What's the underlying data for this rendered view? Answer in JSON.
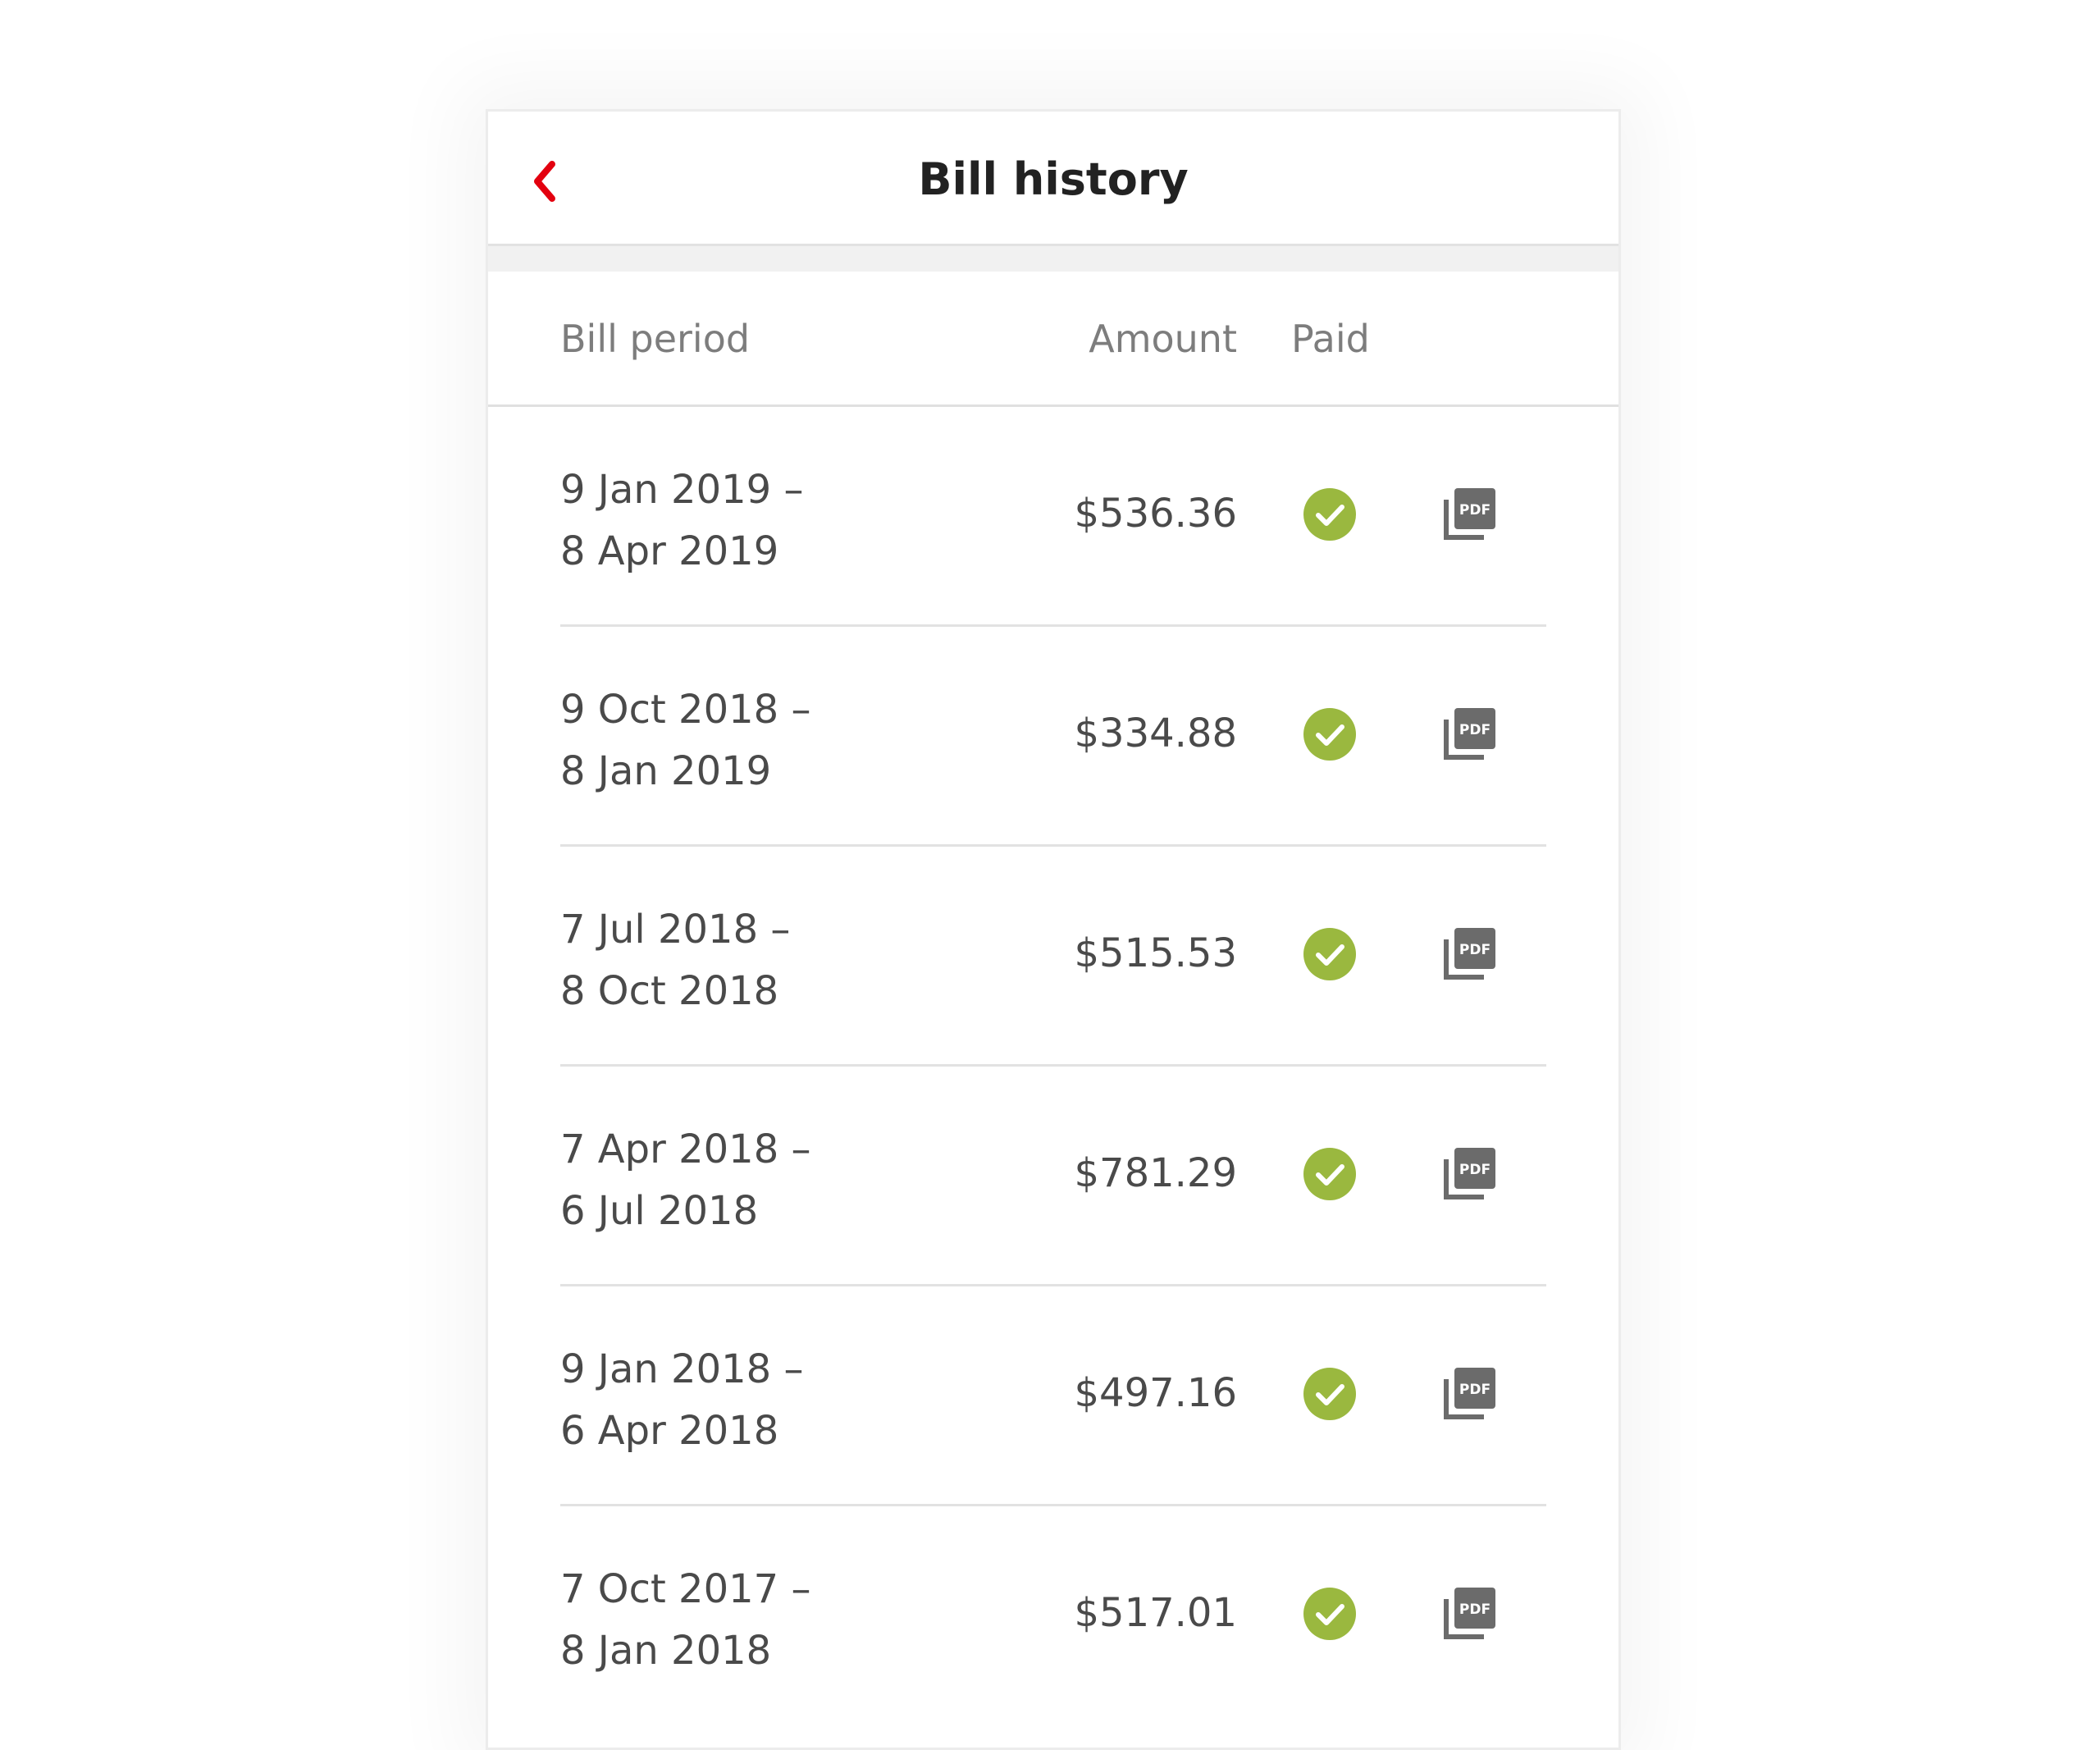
{
  "header": {
    "title": "Bill history",
    "back_icon": "chevron-left-icon",
    "accent_color": "#e3000f"
  },
  "columns": {
    "period": "Bill period",
    "amount": "Amount",
    "paid": "Paid"
  },
  "status_color": "#9ab83f",
  "bills": [
    {
      "start": "9 Jan 2019 –",
      "end": "8 Apr 2019",
      "amount": "$536.36",
      "paid": true,
      "pdf_label": "PDF"
    },
    {
      "start": "9 Oct 2018 –",
      "end": "8 Jan 2019",
      "amount": "$334.88",
      "paid": true,
      "pdf_label": "PDF"
    },
    {
      "start": "7 Jul 2018 –",
      "end": "8 Oct 2018",
      "amount": "$515.53",
      "paid": true,
      "pdf_label": "PDF"
    },
    {
      "start": "7 Apr 2018 –",
      "end": "6 Jul 2018",
      "amount": "$781.29",
      "paid": true,
      "pdf_label": "PDF"
    },
    {
      "start": "9 Jan 2018 –",
      "end": "6 Apr 2018",
      "amount": "$497.16",
      "paid": true,
      "pdf_label": "PDF"
    },
    {
      "start": "7 Oct 2017 –",
      "end": "8 Jan 2018",
      "amount": "$517.01",
      "paid": true,
      "pdf_label": "PDF"
    }
  ]
}
